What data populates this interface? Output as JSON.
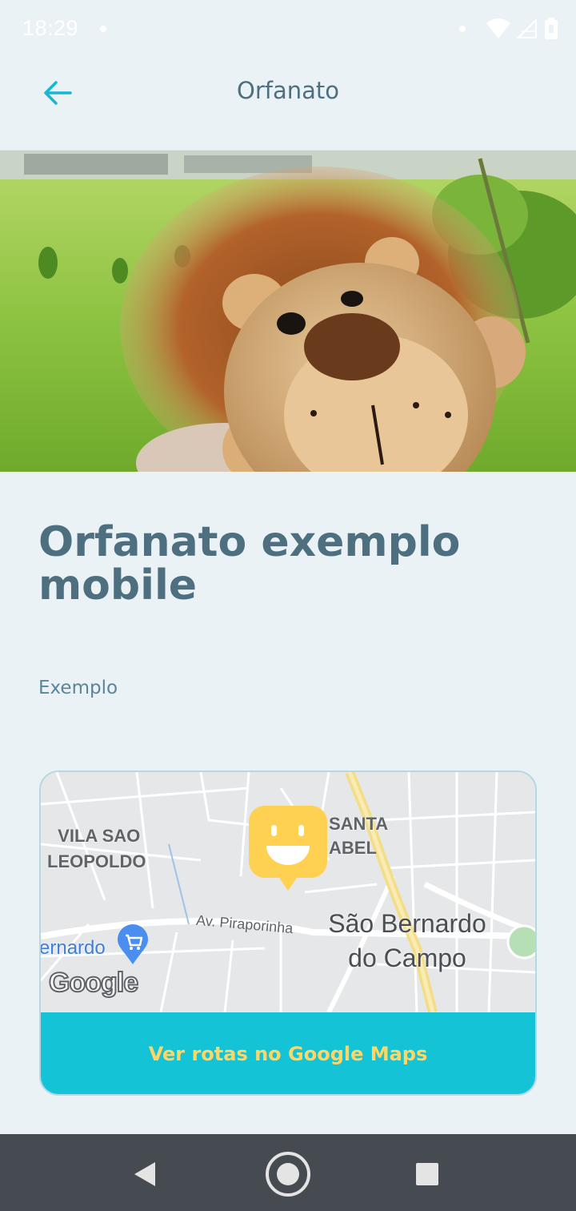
{
  "status_bar": {
    "time": "18:29"
  },
  "header": {
    "title": "Orfanato",
    "back_icon": "arrow-left-icon"
  },
  "hero": {
    "image_description_icon": "photo"
  },
  "details": {
    "title": "Orfanato exemplo mobile",
    "description": "Exemplo"
  },
  "map": {
    "labels": {
      "neighborhood_1_line1": "VILA SAO",
      "neighborhood_1_line2": "LEOPOLDO",
      "neighborhood_2_line1": "SANTA",
      "neighborhood_2_line2": "ABEL",
      "street": "Av. Piraporinha",
      "city_line1": "São Bernardo",
      "city_line2": "do Campo",
      "poi": "ernardo",
      "watermark": "Google"
    },
    "marker_icon": "happy-face-marker-icon",
    "route_button_label": "Ver rotas no Google Maps"
  },
  "colors": {
    "background": "#ebf2f5",
    "title": "#4d6f80",
    "accent": "#15c3d6",
    "button_text": "#ffd666",
    "marker": "#ffd152"
  },
  "nav_bar": {
    "back": "nav-back-icon",
    "home": "nav-home-icon",
    "recents": "nav-recents-icon"
  }
}
